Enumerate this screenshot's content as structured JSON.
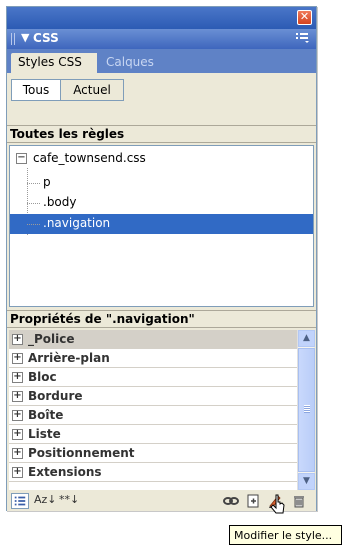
{
  "panel": {
    "close_glyph": "✕",
    "header": {
      "collapse_glyph": "▼",
      "title": "CSS"
    },
    "tabs": [
      {
        "label": "Styles CSS",
        "active": true
      },
      {
        "label": "Calques",
        "active": false
      }
    ],
    "filter": {
      "all_label": "Tous",
      "current_label": "Actuel",
      "selected": "Tous"
    },
    "rules": {
      "header": "Toutes les règles",
      "root": {
        "expander": "⊟",
        "label": "cafe_townsend.css"
      },
      "items": [
        {
          "label": "p",
          "selected": false
        },
        {
          "label": ".body",
          "selected": false
        },
        {
          "label": ".navigation",
          "selected": true
        }
      ]
    },
    "properties": {
      "header": "Propriétés de \".navigation\"",
      "groups": [
        {
          "label": "_Police",
          "selected": true
        },
        {
          "label": "Arrière-plan",
          "selected": false
        },
        {
          "label": "Bloc",
          "selected": false
        },
        {
          "label": "Bordure",
          "selected": false
        },
        {
          "label": "Boîte",
          "selected": false
        },
        {
          "label": "Liste",
          "selected": false
        },
        {
          "label": "Positionnement",
          "selected": false
        },
        {
          "label": "Extensions",
          "selected": false
        }
      ],
      "expander": "⊞"
    },
    "toolbar": {
      "az_label": "Az↓",
      "set_label": "**↓"
    },
    "tooltip": "Modifier le style..."
  },
  "colors": {
    "title_gradient": "#2c5bb4",
    "selection": "#316ac5",
    "panel_bg": "#ece9d8",
    "tooltip_bg": "#ffffe1"
  }
}
